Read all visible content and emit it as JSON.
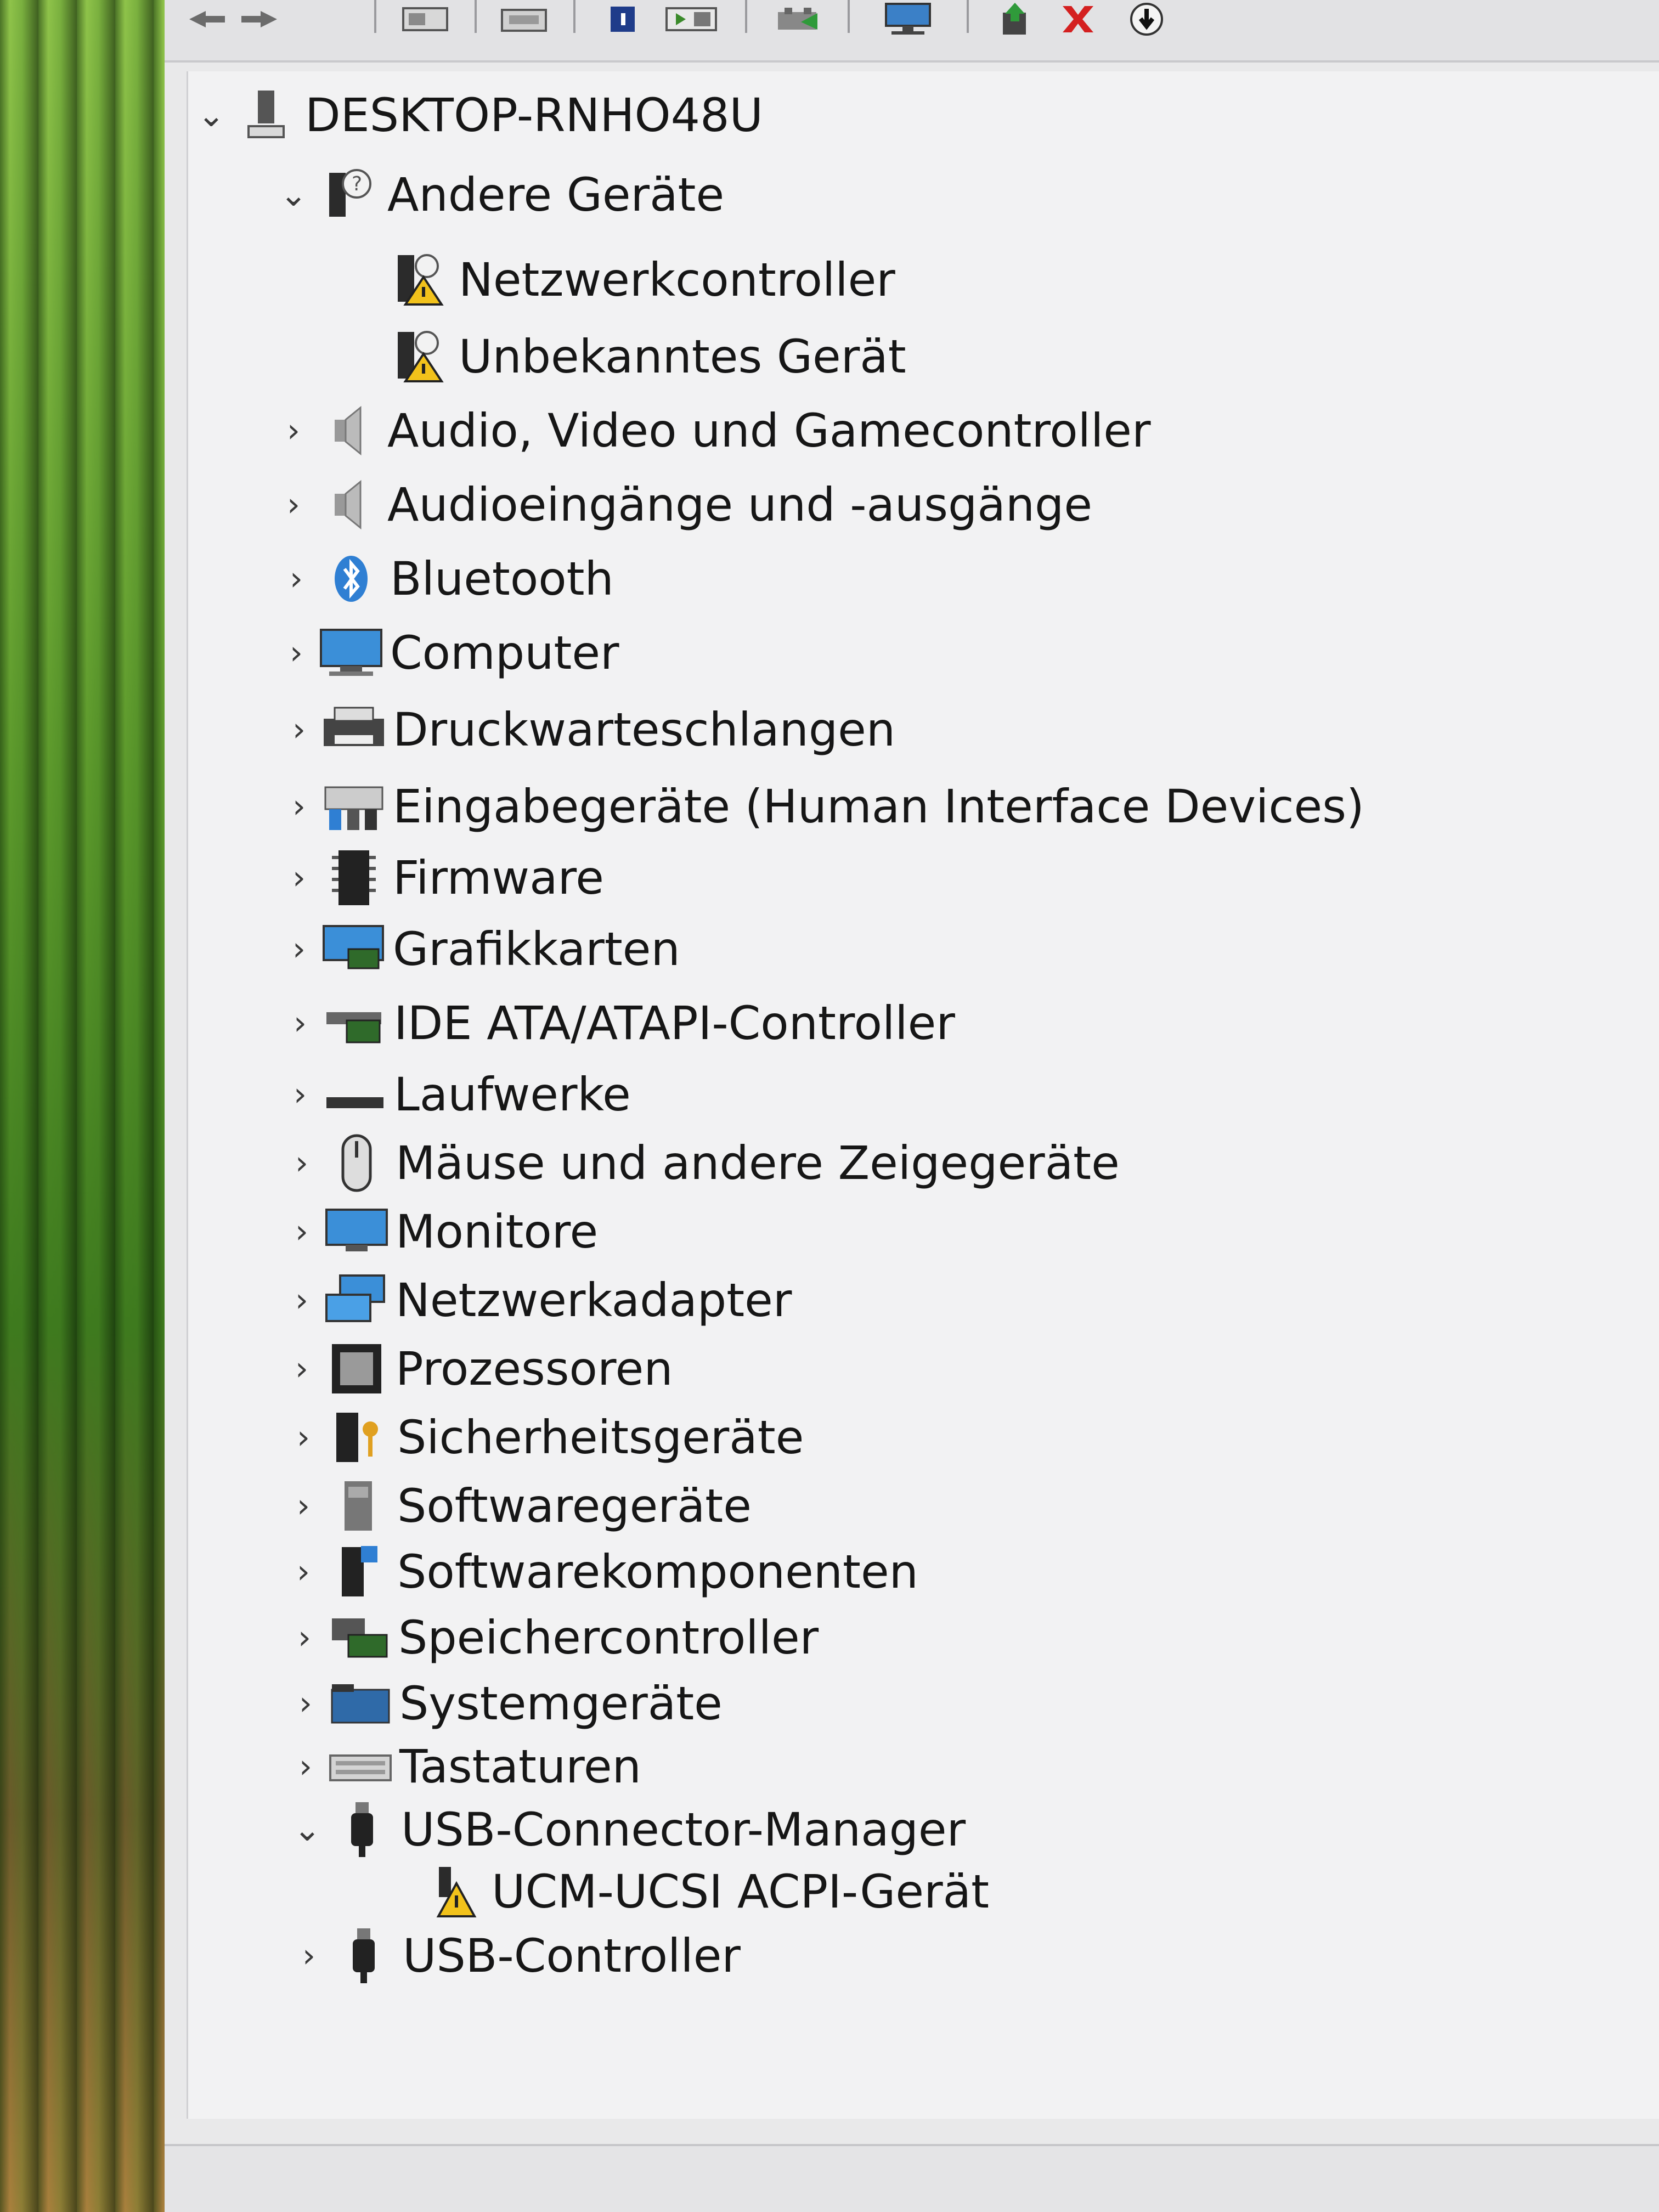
{
  "window": {
    "toolbar_icons": [
      "back-arrow-icon",
      "forward-arrow-icon",
      "properties-icon",
      "print-icon",
      "help-icon",
      "show-hidden-icon",
      "scan-hardware-icon",
      "monitor-computer-icon",
      "update-driver-icon",
      "uninstall-x-icon",
      "disable-device-icon"
    ]
  },
  "tree": {
    "root": {
      "label": "DESKTOP-RNHO48U",
      "expanded": true
    },
    "items": [
      {
        "label": "Andere Geräte",
        "expanded": true,
        "icon": "unknown-device-icon",
        "children": [
          {
            "label": "Netzwerkcontroller",
            "icon": "warning-device-icon"
          },
          {
            "label": "Unbekanntes Gerät",
            "icon": "warning-device-icon"
          }
        ]
      },
      {
        "label": "Audio, Video und Gamecontroller",
        "icon": "speaker-icon"
      },
      {
        "label": "Audioeingänge und -ausgänge",
        "icon": "speaker-icon"
      },
      {
        "label": "Bluetooth",
        "icon": "bluetooth-icon"
      },
      {
        "label": "Computer",
        "icon": "computer-monitor-icon"
      },
      {
        "label": "Druckwarteschlangen",
        "icon": "printer-icon"
      },
      {
        "label": "Eingabegeräte (Human Interface Devices)",
        "icon": "hid-icon"
      },
      {
        "label": "Firmware",
        "icon": "chip-icon"
      },
      {
        "label": "Grafikkarten",
        "icon": "display-adapter-icon"
      },
      {
        "label": "IDE ATA/ATAPI-Controller",
        "icon": "ide-controller-icon"
      },
      {
        "label": "Laufwerke",
        "icon": "drive-icon"
      },
      {
        "label": "Mäuse und andere Zeigegeräte",
        "icon": "mouse-icon"
      },
      {
        "label": "Monitore",
        "icon": "monitor-icon"
      },
      {
        "label": "Netzwerkadapter",
        "icon": "network-adapter-icon"
      },
      {
        "label": "Prozessoren",
        "icon": "processor-icon"
      },
      {
        "label": "Sicherheitsgeräte",
        "icon": "security-key-icon"
      },
      {
        "label": "Softwaregeräte",
        "icon": "software-device-icon"
      },
      {
        "label": "Softwarekomponenten",
        "icon": "software-component-icon"
      },
      {
        "label": "Speichercontroller",
        "icon": "storage-controller-icon"
      },
      {
        "label": "Systemgeräte",
        "icon": "system-folder-icon"
      },
      {
        "label": "Tastaturen",
        "icon": "keyboard-icon"
      },
      {
        "label": "USB-Connector-Manager",
        "expanded": true,
        "icon": "usb-plug-icon",
        "children": [
          {
            "label": "UCM-UCSI ACPI-Gerät",
            "icon": "warning-device-icon"
          }
        ]
      },
      {
        "label": "USB-Controller",
        "icon": "usb-plug-icon"
      }
    ]
  },
  "colors": {
    "accent_blue": "#2f7fd3",
    "warning_yellow": "#f2c21b",
    "uninstall_red": "#d42020"
  }
}
